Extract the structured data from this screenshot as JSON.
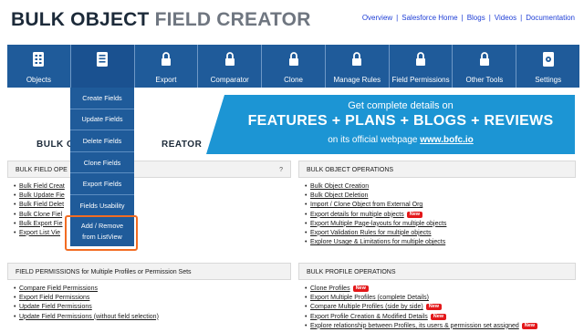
{
  "header": {
    "title_part1": "BULK OBJECT",
    "title_part2": "FIELD CREATOR",
    "links": [
      "Overview",
      "Salesforce Home",
      "Blogs",
      "Videos",
      "Documentation"
    ]
  },
  "nav": {
    "items": [
      {
        "label": "Objects",
        "icon": "objects-icon"
      },
      {
        "label": "",
        "icon": "fields-icon"
      },
      {
        "label": "Export",
        "icon": "lock-icon"
      },
      {
        "label": "Comparator",
        "icon": "lock-icon"
      },
      {
        "label": "Clone",
        "icon": "lock-icon"
      },
      {
        "label": "Manage Rules",
        "icon": "lock-icon"
      },
      {
        "label": "Field Permissions",
        "icon": "lock-icon"
      },
      {
        "label": "Other Tools",
        "icon": "lock-icon"
      },
      {
        "label": "Settings",
        "icon": "settings-icon"
      }
    ]
  },
  "dropdown": {
    "items": [
      "Create Fields",
      "Update Fields",
      "Delete Fields",
      "Clone Fields",
      "Export Fields",
      "Fields Usability"
    ],
    "last_line1": "Add / Remove",
    "last_line2": "from ListView"
  },
  "banner": {
    "logo_left": "BULK O",
    "logo_right": "REATOR",
    "line1": "Get complete details on",
    "line2": "FEATURES + PLANS + BLOGS + REVIEWS",
    "line3_prefix": "on its official webpage",
    "line3_url": "www.bofc.io"
  },
  "panels": {
    "bulk_field": {
      "title": "BULK FIELD OPE",
      "help": "?",
      "items": [
        "Bulk Field Creat",
        "Bulk Update Fie",
        "Bulk Field Delet",
        "Bulk Clone Fiel",
        "Bulk Export Fie",
        "Export List Vie"
      ]
    },
    "bulk_object": {
      "title": "BULK OBJECT OPERATIONS",
      "items": [
        {
          "text": "Bulk Object Creation",
          "badge": ""
        },
        {
          "text": "Bulk Object Deletion",
          "badge": ""
        },
        {
          "text": "Import / Clone Object from External Org",
          "badge": ""
        },
        {
          "text": "Export details for multiple objects",
          "badge": "New"
        },
        {
          "text": "Export Multiple Page-layouts for multiple objects",
          "badge": ""
        },
        {
          "text": "Export Validation Rules for multiple objects",
          "badge": ""
        },
        {
          "text": "Explore Usage & Limitations for multiple objects",
          "badge": ""
        }
      ]
    },
    "field_permissions": {
      "title": "FIELD PERMISSIONS for Multiple Profiles or Permission Sets",
      "items": [
        "Compare Field Permissions",
        "Export Field Permissions",
        "Update Field Permissions",
        "Update Field Permissions (without field selection)"
      ]
    },
    "bulk_profile": {
      "title": "BULK PROFILE OPERATIONS",
      "items": [
        {
          "text": "Clone Profiles",
          "badge": "New"
        },
        {
          "text": "Export Multiple Profiles (complete Details)",
          "badge": ""
        },
        {
          "text": "Compare Multiple Profiles (side by side)",
          "badge": "New"
        },
        {
          "text": "Export Profile Creation & Modified Details",
          "badge": "New"
        },
        {
          "text": "Explore relationship between Profiles, its users & permission set assigned",
          "badge": "New"
        }
      ]
    }
  }
}
